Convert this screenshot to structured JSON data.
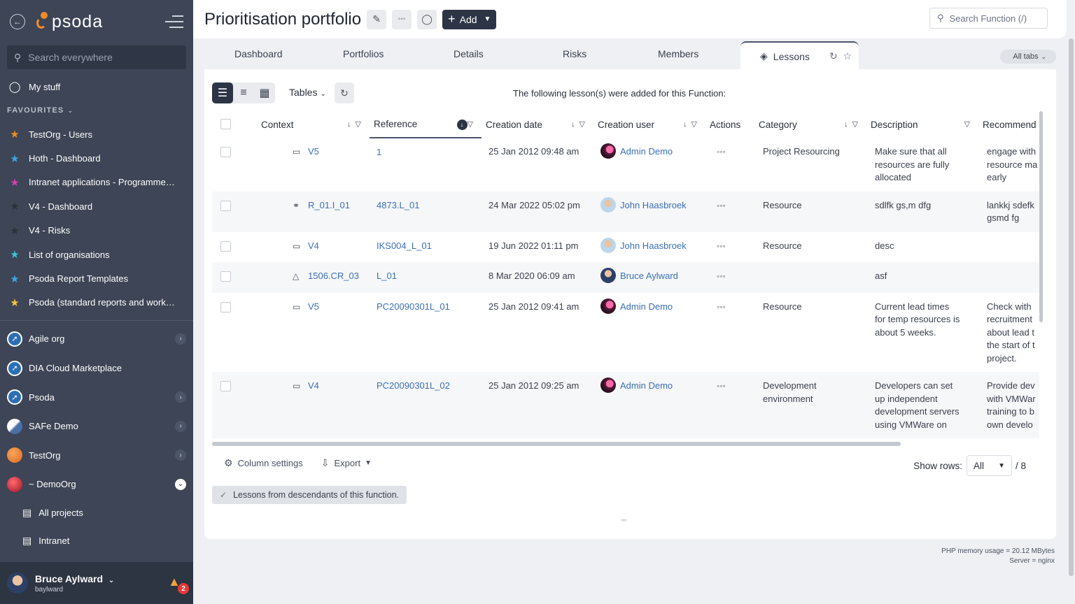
{
  "sidebar": {
    "logo_text": "psoda",
    "search_placeholder": "Search everywhere",
    "my_stuff": "My stuff",
    "favourites_label": "FAVOURITES",
    "favourites": [
      {
        "label": "TestOrg - Users",
        "color": "#f28c28"
      },
      {
        "label": "Hoth - Dashboard",
        "color": "#3ba6e0"
      },
      {
        "label": "Intranet applications - Programme…",
        "color": "#d63fb0"
      },
      {
        "label": "V4 - Dashboard",
        "color": "#2a2f3a"
      },
      {
        "label": "V4 - Risks",
        "color": "#2a2f3a"
      },
      {
        "label": "List of organisations",
        "color": "#3ec3d6"
      },
      {
        "label": "Psoda Report Templates",
        "color": "#3ba6e0"
      },
      {
        "label": "Psoda (standard reports and work…",
        "color": "#f5c542"
      }
    ],
    "orgs": [
      {
        "label": "Agile org",
        "icon": "compass-icon"
      },
      {
        "label": "DIA Cloud Marketplace",
        "icon": "compass-icon"
      },
      {
        "label": "Psoda",
        "icon": "compass-icon"
      },
      {
        "label": "SAFe Demo",
        "icon": "safe-icon"
      },
      {
        "label": "TestOrg",
        "icon": "orange-circle-icon"
      },
      {
        "label": "~ DemoOrg",
        "icon": "red-sphere-icon"
      }
    ],
    "sub_items": [
      {
        "label": "All projects"
      },
      {
        "label": "Intranet"
      }
    ],
    "user": {
      "name": "Bruce Aylward",
      "login": "baylward",
      "notifications": "2"
    }
  },
  "header": {
    "title": "Prioritisation portfolio",
    "add_label": "Add",
    "search_placeholder": "Search Function (/)"
  },
  "tabs": {
    "items": [
      "Dashboard",
      "Portfolios",
      "Details",
      "Risks",
      "Members"
    ],
    "active": "Lessons",
    "all_tabs": "All tabs"
  },
  "toolbar": {
    "tables_label": "Tables",
    "caption": "The following lesson(s) were added for this Function:"
  },
  "table": {
    "columns": [
      "Context",
      "Reference",
      "Creation date",
      "Creation user",
      "Actions",
      "Category",
      "Description",
      "Recommend"
    ],
    "rows": [
      {
        "context": "V5",
        "context_icon": "monitor-icon",
        "reference": "1",
        "date": "25 Jan 2012 09:48 am",
        "user": "Admin Demo",
        "avatar": "admin",
        "category": "Project Resourcing",
        "description": [
          "Make sure that all",
          "resources are fully",
          "allocated"
        ],
        "recommendation": [
          "engage with",
          "resource ma",
          "early"
        ]
      },
      {
        "context": "R_01.I_01",
        "context_icon": "risk-icon",
        "reference": "4873.L_01",
        "date": "24 Mar 2022 05:02 pm",
        "user": "John Haasbroek",
        "avatar": "john",
        "category": "Resource",
        "description": [
          "sdlfk gs,m dfg"
        ],
        "recommendation": [
          "lankkj sdefk",
          "gsmd fg"
        ]
      },
      {
        "context": "V4",
        "context_icon": "monitor-icon",
        "reference": "IKS004_L_01",
        "date": "19 Jun 2022 01:11 pm",
        "user": "John Haasbroek",
        "avatar": "john",
        "category": "Resource",
        "description": [
          "desc"
        ],
        "recommendation": [
          ""
        ]
      },
      {
        "context": "1506.CR_03",
        "context_icon": "change-request-icon",
        "reference": "L_01",
        "date": "8 Mar 2020 06:09 am",
        "user": "Bruce Aylward",
        "avatar": "bruce",
        "category": "",
        "description": [
          "asf"
        ],
        "recommendation": [
          ""
        ]
      },
      {
        "context": "V5",
        "context_icon": "monitor-icon",
        "reference": "PC20090301L_01",
        "date": "25 Jan 2012 09:41 am",
        "user": "Admin Demo",
        "avatar": "admin",
        "category": "Resource",
        "description": [
          "Current lead times",
          "for temp resources is",
          "about 5 weeks."
        ],
        "recommendation": [
          "Check with",
          "recruitment",
          "about lead t",
          "the start of t",
          "project."
        ]
      },
      {
        "context": "V4",
        "context_icon": "monitor-icon",
        "reference": "PC20090301L_02",
        "date": "25 Jan 2012 09:25 am",
        "user": "Admin Demo",
        "avatar": "admin",
        "category": "Development environment",
        "description": [
          "Developers can set",
          "up independent",
          "development servers",
          "using VMWare on"
        ],
        "recommendation": [
          "Provide dev",
          "with VMWar",
          "training to b",
          "own develo"
        ]
      }
    ]
  },
  "footer": {
    "column_settings": "Column settings",
    "export": "Export",
    "show_rows_label": "Show rows:",
    "show_rows_value": "All",
    "total": "/ 8",
    "descendants": "Lessons from descendants of this function."
  },
  "server_info": {
    "memory": "PHP memory usage = 20.12 MBytes",
    "server": "Server = nginx"
  }
}
